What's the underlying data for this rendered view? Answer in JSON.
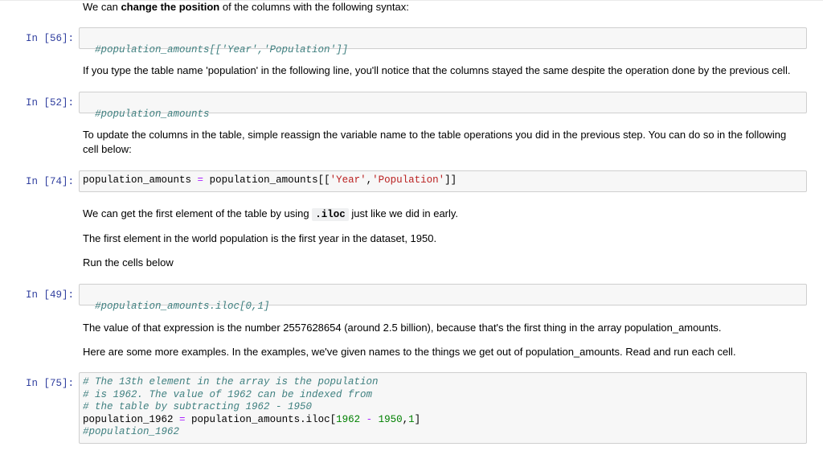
{
  "md1": {
    "pre": "We can ",
    "bold": "change the position",
    "post": " of the columns with the following syntax:"
  },
  "cell56": {
    "prompt": "In [56]:",
    "code": "#population_amounts[['Year','Population']]"
  },
  "md2": "If you type the table name 'population' in the following line, you'll notice that the columns stayed the same despite the operation done by the previous cell.",
  "cell52": {
    "prompt": "In [52]:",
    "code": "#population_amounts"
  },
  "md3": "To update the columns in the table, simple reassign the variable name to the table operations you did in the previous step. You can do so in the following cell below:",
  "cell74": {
    "prompt": "In [74]:",
    "var": "population_amounts",
    "eq": "=",
    "rhs": "population_amounts[[",
    "s1": "'Year'",
    "comma": ",",
    "s2": "'Population'",
    "close": "]]"
  },
  "md4": {
    "pre": "We can get the first element of the table by using ",
    "code": ".iloc",
    "post": " just like we did in early."
  },
  "md5": "The first element in the world population is the first year in the dataset, 1950.",
  "md6": "Run the cells below",
  "cell49": {
    "prompt": "In [49]:",
    "code": "#population_amounts.iloc[0,1]"
  },
  "md7": "The value of that expression is the number 2557628654 (around 2.5 billion), because that's the first thing in the array population_amounts.",
  "md8": "Here are some more examples. In the examples, we've given names to the things we get out of population_amounts. Read and run each cell.",
  "cell75": {
    "prompt": "In [75]:",
    "c1": "# The 13th element in the array is the population",
    "c2": "# is 1962. The value of 1962 can be indexed from",
    "c3": "# the table by subtracting 1962 - 1950",
    "l4a": "population_1962 ",
    "l4eq": "=",
    "l4b": " population_amounts.iloc[",
    "l4n1": "1962",
    "l4minus": " - ",
    "l4n2": "1950",
    "l4c": ",",
    "l4n3": "1",
    "l4d": "]",
    "c5": "#population_1962"
  }
}
